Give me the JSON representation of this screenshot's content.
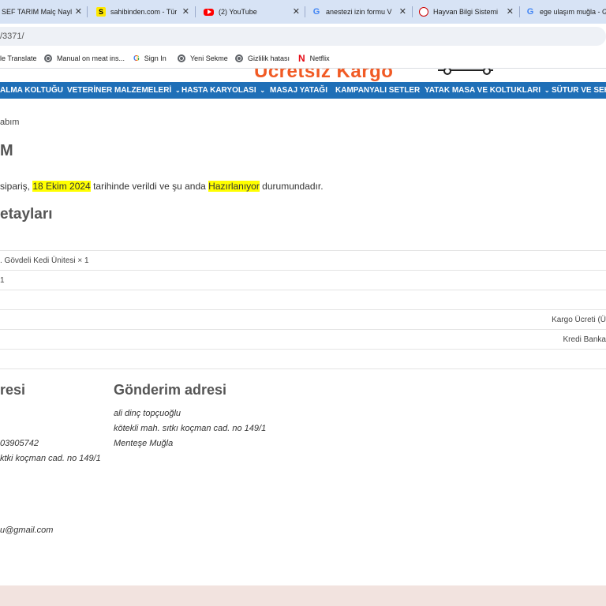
{
  "browser": {
    "tabs": [
      {
        "title": "SEF TARIM Malç Nayl",
        "icon": "sef-tarim-favicon"
      },
      {
        "title": "sahibinden.com - Tür",
        "icon": "sahibinden-favicon",
        "icon_glyph": "S"
      },
      {
        "title": "(2) YouTube",
        "icon": "youtube-favicon"
      },
      {
        "title": "anestezi izin formu V",
        "icon": "google-favicon",
        "icon_glyph": "G"
      },
      {
        "title": "Hayvan Bilgi Sistemi",
        "icon": "hayvan-bilgi-favicon"
      },
      {
        "title": "ege ulaşım muğla - G",
        "icon": "google-favicon",
        "icon_glyph": "G"
      }
    ],
    "close_glyph": "✕",
    "url": "/3371/",
    "bookmarks": [
      {
        "label": "le Translate"
      },
      {
        "label": "Manual on meat ins...",
        "icon": "globe-icon"
      },
      {
        "label": "Sign In",
        "icon": "google-icon",
        "icon_glyph": "G"
      },
      {
        "label": "Yeni Sekme",
        "icon": "globe-icon"
      },
      {
        "label": "Gizlilik hatası",
        "icon": "globe-icon"
      },
      {
        "label": "Netflix",
        "icon": "netflix-icon",
        "icon_glyph": "N"
      }
    ]
  },
  "site": {
    "promo_text": "Ücretsiz Kargo",
    "nav": [
      {
        "label": "ALMA KOLTUĞU"
      },
      {
        "label": "VETERİNER MALZEMELERİ",
        "chevron": "⌄"
      },
      {
        "label": "HASTA KARYOLASI",
        "chevron": "⌄"
      },
      {
        "label": "MASAJ YATAĞI"
      },
      {
        "label": "KAMPANYALI SETLER"
      },
      {
        "label": "YATAK MASA VE KOLTUKLARI",
        "chevron": "⌄"
      },
      {
        "label": "SÜTUR VE SEHP"
      }
    ],
    "colors": {
      "nav_bg": "#1f6fb7",
      "promo": "#f15a24",
      "highlight": "#ffff00",
      "footer_bg": "#f2e3df"
    }
  },
  "page": {
    "breadcrumb": "abım",
    "heading": "M",
    "status": {
      "prefix": "sipariş, ",
      "date": "18 Ekim 2024",
      "middle": " tarihinde verildi ve şu anda ",
      "state": "Hazırlanıyor",
      "suffix": " durumundadır."
    },
    "details_heading": "etayları",
    "rows": [
      {
        "left": ". Gövdeli Kedi Ünitesi × 1",
        "right": ""
      },
      {
        "left": "1",
        "right": ""
      },
      {
        "left": "",
        "right": ""
      },
      {
        "left": "",
        "right": "Kargo Ücreti (Ü"
      },
      {
        "left": "",
        "right": "Kredi Banka"
      },
      {
        "left": "",
        "right": ""
      }
    ],
    "billing": {
      "heading": "resi",
      "lines": [
        "03905742",
        "ktki koçman cad. no 149/1",
        "u@gmail.com"
      ]
    },
    "shipping": {
      "heading": "Gönderim adresi",
      "lines": [
        "ali dinç topçuoğlu",
        "kötekli mah. sıtkı koçman cad. no 149/1",
        "Menteşe Muğla"
      ]
    }
  }
}
